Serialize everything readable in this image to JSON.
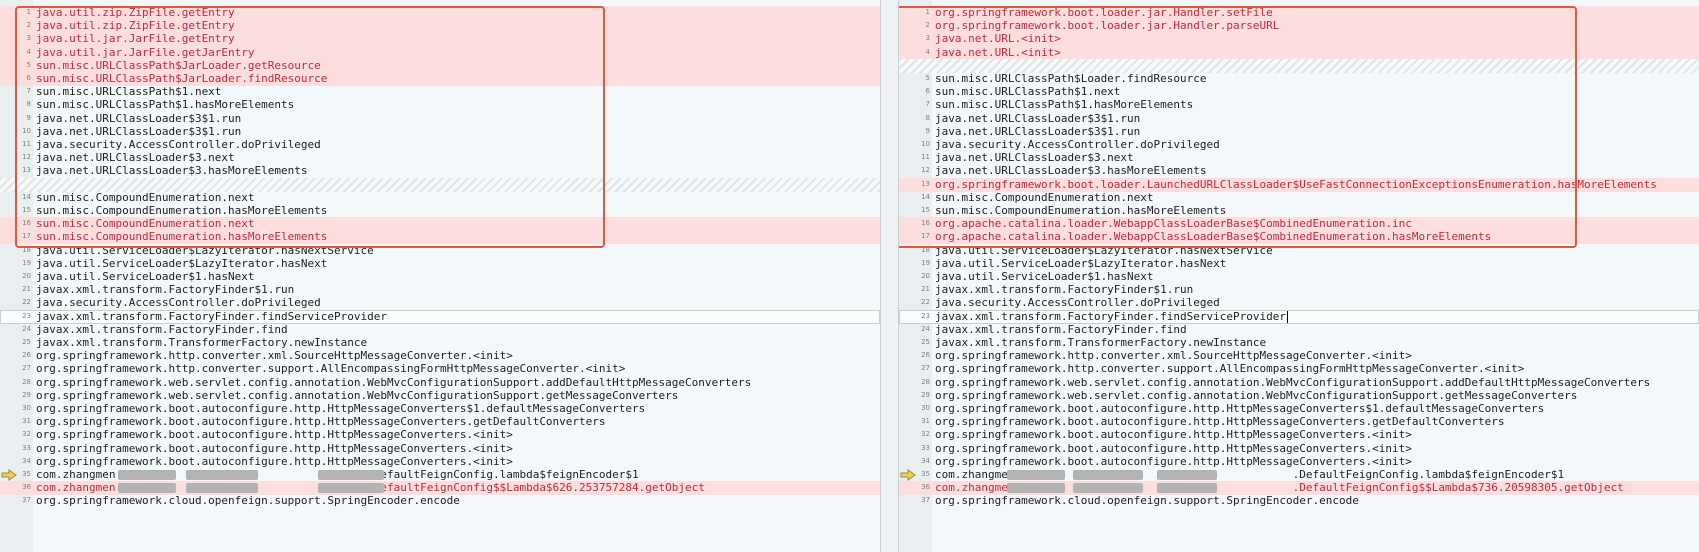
{
  "left": {
    "lines": [
      {
        "n": "1",
        "text": "java.util.zip.ZipFile.getEntry",
        "state": "changed"
      },
      {
        "n": "2",
        "text": "java.util.zip.ZipFile.getEntry",
        "state": "changed"
      },
      {
        "n": "3",
        "text": "java.util.jar.JarFile.getEntry",
        "state": "changed"
      },
      {
        "n": "4",
        "text": "java.util.jar.JarFile.getJarEntry",
        "state": "changed"
      },
      {
        "n": "5",
        "text": "sun.misc.URLClassPath$JarLoader.getResource",
        "state": "changed"
      },
      {
        "n": "6",
        "text": "sun.misc.URLClassPath$JarLoader.findResource",
        "state": "changed"
      },
      {
        "n": "7",
        "text": "sun.misc.URLClassPath$1.next",
        "state": "normal"
      },
      {
        "n": "8",
        "text": "sun.misc.URLClassPath$1.hasMoreElements",
        "state": "normal"
      },
      {
        "n": "9",
        "text": "java.net.URLClassLoader$3$1.run",
        "state": "normal"
      },
      {
        "n": "10",
        "text": "java.net.URLClassLoader$3$1.run",
        "state": "normal"
      },
      {
        "n": "11",
        "text": "java.security.AccessController.doPrivileged",
        "state": "normal"
      },
      {
        "n": "12",
        "text": "java.net.URLClassLoader$3.next",
        "state": "normal"
      },
      {
        "n": "13",
        "text": "java.net.URLClassLoader$3.hasMoreElements",
        "state": "normal"
      },
      {
        "n": "",
        "text": "",
        "state": "hatch"
      },
      {
        "n": "14",
        "text": "sun.misc.CompoundEnumeration.next",
        "state": "normal"
      },
      {
        "n": "15",
        "text": "sun.misc.CompoundEnumeration.hasMoreElements",
        "state": "normal"
      },
      {
        "n": "16",
        "text": "sun.misc.CompoundEnumeration.next",
        "state": "changed"
      },
      {
        "n": "17",
        "text": "sun.misc.CompoundEnumeration.hasMoreElements",
        "state": "changed"
      },
      {
        "n": "18",
        "text": "java.util.ServiceLoader$LazyIterator.hasNextService",
        "state": "normal"
      },
      {
        "n": "19",
        "text": "java.util.ServiceLoader$LazyIterator.hasNext",
        "state": "normal"
      },
      {
        "n": "20",
        "text": "java.util.ServiceLoader$1.hasNext",
        "state": "normal"
      },
      {
        "n": "21",
        "text": "javax.xml.transform.FactoryFinder$1.run",
        "state": "normal"
      },
      {
        "n": "22",
        "text": "java.security.AccessController.doPrivileged",
        "state": "normal"
      },
      {
        "n": "23",
        "text": "javax.xml.transform.FactoryFinder.findServiceProvider",
        "state": "current"
      },
      {
        "n": "24",
        "text": "javax.xml.transform.FactoryFinder.find",
        "state": "normal"
      },
      {
        "n": "25",
        "text": "javax.xml.transform.TransformerFactory.newInstance",
        "state": "normal"
      },
      {
        "n": "26",
        "text": "org.springframework.http.converter.xml.SourceHttpMessageConverter.<init>",
        "state": "normal"
      },
      {
        "n": "27",
        "text": "org.springframework.http.converter.support.AllEncompassingFormHttpMessageConverter.<init>",
        "state": "normal"
      },
      {
        "n": "28",
        "text": "org.springframework.web.servlet.config.annotation.WebMvcConfigurationSupport.addDefaultHttpMessageConverters",
        "state": "normal"
      },
      {
        "n": "29",
        "text": "org.springframework.web.servlet.config.annotation.WebMvcConfigurationSupport.getMessageConverters",
        "state": "normal"
      },
      {
        "n": "30",
        "text": "org.springframework.boot.autoconfigure.http.HttpMessageConverters$1.defaultMessageConverters",
        "state": "normal"
      },
      {
        "n": "31",
        "text": "org.springframework.boot.autoconfigure.http.HttpMessageConverters.getDefaultConverters",
        "state": "normal"
      },
      {
        "n": "32",
        "text": "org.springframework.boot.autoconfigure.http.HttpMessageConverters.<init>",
        "state": "normal"
      },
      {
        "n": "33",
        "text": "org.springframework.boot.autoconfigure.http.HttpMessageConverters.<init>",
        "state": "normal"
      },
      {
        "n": "34",
        "text": "org.springframework.boot.autoconfigure.http.HttpMessageConverters.<init>",
        "state": "normal"
      },
      {
        "n": "35",
        "text": "com.zhangmen.                                     .DefaultFeignConfig.lambda$feignEncoder$1",
        "state": "normal",
        "mask": true
      },
      {
        "n": "36",
        "text": "com.zhangmen.                                     .DefaultFeignConfig$$Lambda$626.253757284.getObject",
        "state": "changed",
        "mask": true
      },
      {
        "n": "37",
        "text": "org.springframework.cloud.openfeign.support.SpringEncoder.encode",
        "state": "normal"
      }
    ]
  },
  "right": {
    "lines": [
      {
        "n": "1",
        "text": "org.springframework.boot.loader.jar.Handler.setFile",
        "state": "changed"
      },
      {
        "n": "2",
        "text": "org.springframework.boot.loader.jar.Handler.parseURL",
        "state": "changed"
      },
      {
        "n": "3",
        "text": "java.net.URL.<init>",
        "state": "changed"
      },
      {
        "n": "4",
        "text": "java.net.URL.<init>",
        "state": "changed"
      },
      {
        "n": "",
        "text": "",
        "state": "hatch"
      },
      {
        "n": "5",
        "text": "sun.misc.URLClassPath$Loader.findResource",
        "state": "normal"
      },
      {
        "n": "6",
        "text": "sun.misc.URLClassPath$1.next",
        "state": "normal"
      },
      {
        "n": "7",
        "text": "sun.misc.URLClassPath$1.hasMoreElements",
        "state": "normal"
      },
      {
        "n": "8",
        "text": "java.net.URLClassLoader$3$1.run",
        "state": "normal"
      },
      {
        "n": "9",
        "text": "java.net.URLClassLoader$3$1.run",
        "state": "normal"
      },
      {
        "n": "10",
        "text": "java.security.AccessController.doPrivileged",
        "state": "normal"
      },
      {
        "n": "11",
        "text": "java.net.URLClassLoader$3.next",
        "state": "normal"
      },
      {
        "n": "12",
        "text": "java.net.URLClassLoader$3.hasMoreElements",
        "state": "normal"
      },
      {
        "n": "13",
        "text": "org.springframework.boot.loader.LaunchedURLClassLoader$UseFastConnectionExceptionsEnumeration.hasMoreElements",
        "state": "changed"
      },
      {
        "n": "14",
        "text": "sun.misc.CompoundEnumeration.next",
        "state": "normal"
      },
      {
        "n": "15",
        "text": "sun.misc.CompoundEnumeration.hasMoreElements",
        "state": "normal"
      },
      {
        "n": "16",
        "text": "org.apache.catalina.loader.WebappClassLoaderBase$CombinedEnumeration.inc",
        "state": "changed"
      },
      {
        "n": "17",
        "text": "org.apache.catalina.loader.WebappClassLoaderBase$CombinedEnumeration.hasMoreElements",
        "state": "changed"
      },
      {
        "n": "18",
        "text": "java.util.ServiceLoader$LazyIterator.hasNextService",
        "state": "normal"
      },
      {
        "n": "19",
        "text": "java.util.ServiceLoader$LazyIterator.hasNext",
        "state": "normal"
      },
      {
        "n": "20",
        "text": "java.util.ServiceLoader$1.hasNext",
        "state": "normal"
      },
      {
        "n": "21",
        "text": "javax.xml.transform.FactoryFinder$1.run",
        "state": "normal"
      },
      {
        "n": "22",
        "text": "java.security.AccessController.doPrivileged",
        "state": "normal"
      },
      {
        "n": "23",
        "text": "javax.xml.transform.FactoryFinder.findServiceProvider",
        "state": "current"
      },
      {
        "n": "24",
        "text": "javax.xml.transform.FactoryFinder.find",
        "state": "normal"
      },
      {
        "n": "25",
        "text": "javax.xml.transform.TransformerFactory.newInstance",
        "state": "normal"
      },
      {
        "n": "26",
        "text": "org.springframework.http.converter.xml.SourceHttpMessageConverter.<init>",
        "state": "normal"
      },
      {
        "n": "27",
        "text": "org.springframework.http.converter.support.AllEncompassingFormHttpMessageConverter.<init>",
        "state": "normal"
      },
      {
        "n": "28",
        "text": "org.springframework.web.servlet.config.annotation.WebMvcConfigurationSupport.addDefaultHttpMessageConverters",
        "state": "normal"
      },
      {
        "n": "29",
        "text": "org.springframework.web.servlet.config.annotation.WebMvcConfigurationSupport.getMessageConverters",
        "state": "normal"
      },
      {
        "n": "30",
        "text": "org.springframework.boot.autoconfigure.http.HttpMessageConverters$1.defaultMessageConverters",
        "state": "normal"
      },
      {
        "n": "31",
        "text": "org.springframework.boot.autoconfigure.http.HttpMessageConverters.getDefaultConverters",
        "state": "normal"
      },
      {
        "n": "32",
        "text": "org.springframework.boot.autoconfigure.http.HttpMessageConverters.<init>",
        "state": "normal"
      },
      {
        "n": "33",
        "text": "org.springframework.boot.autoconfigure.http.HttpMessageConverters.<init>",
        "state": "normal"
      },
      {
        "n": "34",
        "text": "org.springframework.boot.autoconfigure.http.HttpMessageConverters.<init>",
        "state": "normal"
      },
      {
        "n": "35",
        "text": "com.zhangmen                                          .DefaultFeignConfig.lambda$feignEncoder$1",
        "state": "normal",
        "mask": true
      },
      {
        "n": "36",
        "text": "com.zhangmen                                          .DefaultFeignConfig$$Lambda$736.20598305.getObject",
        "state": "changed",
        "mask": true
      },
      {
        "n": "37",
        "text": "org.springframework.cloud.openfeign.support.SpringEncoder.encode",
        "state": "normal"
      }
    ]
  },
  "colors": {
    "changed_bg": "#fcdede",
    "changed_text": "#c6283a",
    "highlight_box": "#e0573a",
    "arrow": "#e0b23a"
  },
  "icons": {
    "diff_arrow": "arrow-right-icon"
  }
}
